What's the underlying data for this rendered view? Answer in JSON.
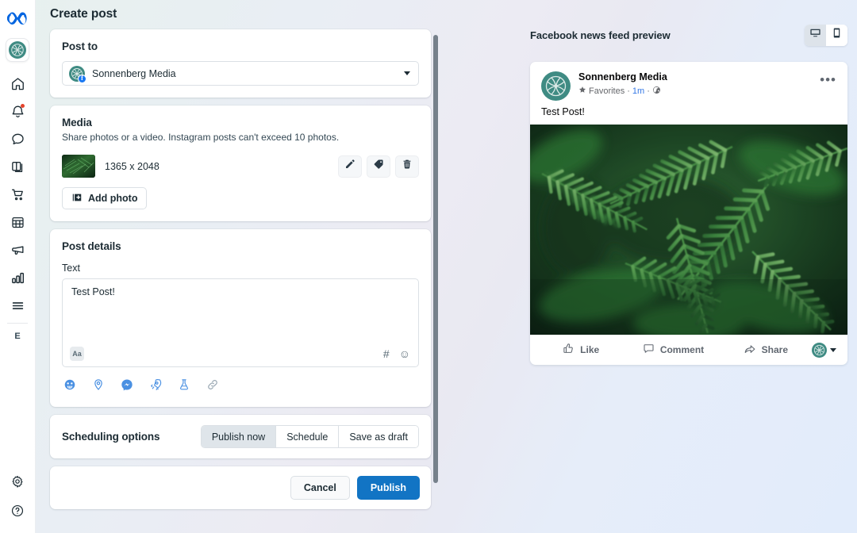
{
  "app": {
    "logo_icon": "meta-logo-icon",
    "brand_name": "Sonnenberg Media"
  },
  "sidebar": {
    "items": [
      {
        "icon": "home-icon",
        "name": "home"
      },
      {
        "icon": "bell-icon",
        "name": "notifications",
        "badge": true
      },
      {
        "icon": "chat-bubble-icon",
        "name": "messages"
      },
      {
        "icon": "content-library-icon",
        "name": "content"
      },
      {
        "icon": "shopping-cart-icon",
        "name": "commerce"
      },
      {
        "icon": "calendar-grid-icon",
        "name": "planner"
      },
      {
        "icon": "megaphone-icon",
        "name": "ads"
      },
      {
        "icon": "bar-chart-icon",
        "name": "insights"
      },
      {
        "icon": "hamburger-menu-icon",
        "name": "all-tools"
      }
    ],
    "account_initial": "E",
    "bottom_items": [
      {
        "icon": "gear-icon",
        "name": "settings"
      },
      {
        "icon": "question-circle-icon",
        "name": "help"
      }
    ]
  },
  "header": {
    "title": "Create post"
  },
  "post_to": {
    "title": "Post to",
    "selected": "Sonnenberg Media",
    "platform_badge": "facebook-badge-icon",
    "caret_icon": "chevron-down-icon"
  },
  "media": {
    "title": "Media",
    "description": "Share photos or a video. Instagram posts can't exceed 10 photos.",
    "item_dimensions": "1365 x 2048",
    "actions": [
      {
        "icon": "pencil-icon",
        "name": "edit-media"
      },
      {
        "icon": "tag-icon",
        "name": "tag-media"
      },
      {
        "icon": "trash-icon",
        "name": "delete-media"
      }
    ],
    "add_photo_label": "Add photo",
    "add_photo_icon": "add-photo-icon"
  },
  "post_details": {
    "title": "Post details",
    "text_label": "Text",
    "text_value": "Test Post!",
    "text_placeholder": "",
    "format_button": "Aa",
    "inline_tools": [
      {
        "icon": "hashtag-icon",
        "name": "hashtag"
      },
      {
        "icon": "emoji-icon",
        "name": "emoji-picker"
      }
    ],
    "tools": [
      {
        "icon": "sticker-face-icon",
        "name": "feeling-activity"
      },
      {
        "icon": "location-pin-icon",
        "name": "check-in"
      },
      {
        "icon": "messenger-icon",
        "name": "messenger-cta"
      },
      {
        "icon": "rocket-icon",
        "name": "boost-post"
      },
      {
        "icon": "flask-icon",
        "name": "ab-test"
      },
      {
        "icon": "link-icon",
        "name": "add-link"
      }
    ]
  },
  "scheduling": {
    "title": "Scheduling options",
    "options": [
      {
        "label": "Publish now",
        "active": true
      },
      {
        "label": "Schedule",
        "active": false
      },
      {
        "label": "Save as draft",
        "active": false
      }
    ]
  },
  "footer_actions": {
    "cancel_label": "Cancel",
    "publish_label": "Publish"
  },
  "preview": {
    "title": "Facebook news feed preview",
    "devices": [
      {
        "icon": "desktop-icon",
        "name": "desktop",
        "active": true
      },
      {
        "icon": "mobile-icon",
        "name": "mobile",
        "active": false
      }
    ],
    "post": {
      "author": "Sonnenberg Media",
      "audience": "Favorites",
      "timestamp": "1m",
      "privacy_icon": "globe-icon",
      "star_icon": "star-icon",
      "menu_icon": "ellipsis-icon",
      "body_text": "Test Post!",
      "image_alt": "green fern fronds photo",
      "actions": [
        {
          "label": "Like",
          "icon": "thumbs-up-icon"
        },
        {
          "label": "Comment",
          "icon": "comment-icon"
        },
        {
          "label": "Share",
          "icon": "share-arrow-icon"
        }
      ],
      "share_as_caret": "chevron-down-icon"
    }
  },
  "colors": {
    "accent_blue": "#1274c4",
    "link_blue": "#3578e5",
    "brand_teal": "#3f8b83",
    "facebook_blue": "#1877f2",
    "notification_red": "#e5422b",
    "text_dark": "#1c2b33",
    "text_muted": "#65676b"
  }
}
